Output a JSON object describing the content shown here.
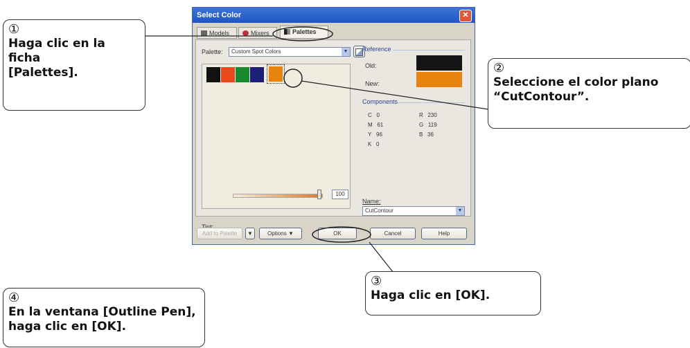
{
  "dialog": {
    "title": "Select Color",
    "close_glyph": "✕",
    "tabs": [
      {
        "label": "Models",
        "icon": "models-icon"
      },
      {
        "label": "Mixers",
        "icon": "mixers-icon"
      },
      {
        "label": "Palettes",
        "icon": "palettes-icon"
      }
    ],
    "palette_label": "Palette:",
    "palette_value": "Custom Spot Colors",
    "swatches": [
      "#111111",
      "#e8491a",
      "#1a8a2e",
      "#1b1f78",
      "#e8820e"
    ],
    "reference": {
      "title": "Reference",
      "old_label": "Old:",
      "new_label": "New:",
      "old_color": "#141414",
      "new_color": "#e8820e"
    },
    "components": {
      "title": "Components",
      "left": [
        {
          "k": "C",
          "v": "0"
        },
        {
          "k": "M",
          "v": "61"
        },
        {
          "k": "Y",
          "v": "96"
        },
        {
          "k": "K",
          "v": "0"
        }
      ],
      "right": [
        {
          "k": "R",
          "v": "230"
        },
        {
          "k": "G",
          "v": "119"
        },
        {
          "k": "B",
          "v": "36"
        }
      ]
    },
    "tint_label": "Tint:",
    "tint_value": "100",
    "name_label": "Name:",
    "name_value": "CutContour",
    "buttons": {
      "add_palette": "Add to Palette",
      "options": "Options",
      "ok": "OK",
      "cancel": "Cancel",
      "help": "Help"
    },
    "arrow_glyph": "▼"
  },
  "callouts": {
    "c1": {
      "num": "①",
      "text": "Haga clic en la\nficha\n[Palettes]."
    },
    "c2": {
      "num": "②",
      "text": "Seleccione el color plano\n“CutContour”."
    },
    "c3": {
      "num": "③",
      "text": "Haga clic en [OK]."
    },
    "c4": {
      "num": "④",
      "text": "En la ventana [Outline Pen],\nhaga clic en [OK]."
    }
  }
}
